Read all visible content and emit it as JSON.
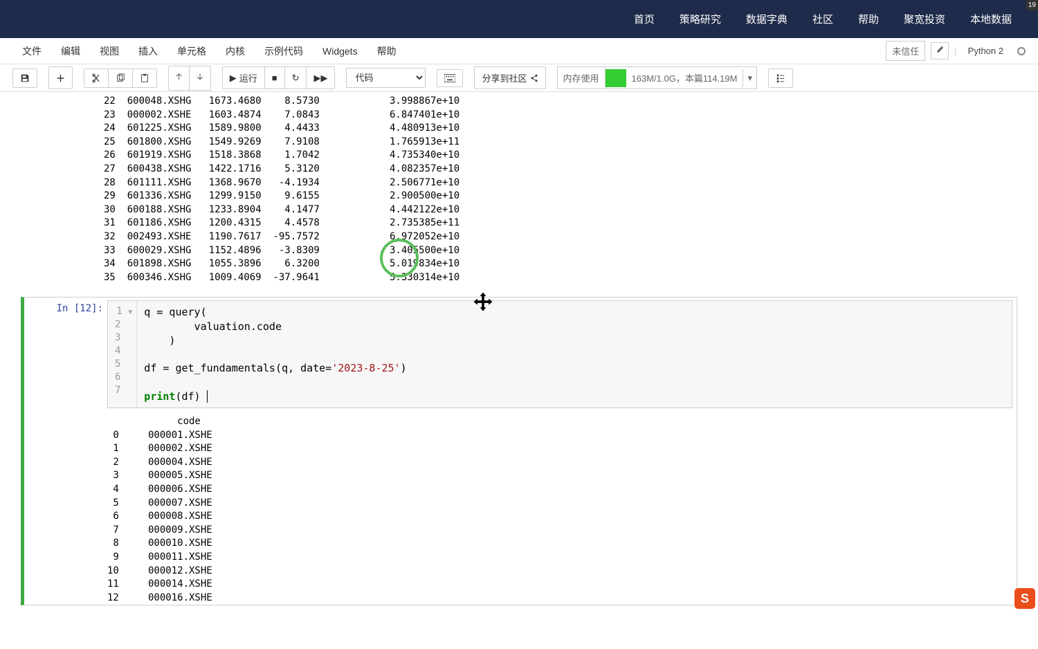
{
  "nav": {
    "items": [
      "首页",
      "策略研究",
      "数据字典",
      "社区",
      "帮助",
      "聚宽投资",
      "本地数据"
    ],
    "badge": "19"
  },
  "menu": {
    "items": [
      "文件",
      "编辑",
      "视图",
      "插入",
      "单元格",
      "内核",
      "示例代码",
      "Widgets",
      "帮助"
    ],
    "trusted": "未信任",
    "kernel": "Python 2"
  },
  "toolbar": {
    "run_label": "运行",
    "cell_type_selected": "代码",
    "share_label": "分享到社区",
    "mem_label": "内存使用",
    "mem_text": "163M/1.0G，本篇114.19M"
  },
  "output_top": {
    "rows": [
      {
        "idx": "22",
        "code": "600048.XSHG",
        "v1": "1673.4680",
        "v2": "8.5730",
        "v3": "3.998867e+10"
      },
      {
        "idx": "23",
        "code": "000002.XSHE",
        "v1": "1603.4874",
        "v2": "7.0843",
        "v3": "6.847401e+10"
      },
      {
        "idx": "24",
        "code": "601225.XSHG",
        "v1": "1589.9800",
        "v2": "4.4433",
        "v3": "4.480913e+10"
      },
      {
        "idx": "25",
        "code": "601800.XSHG",
        "v1": "1549.9269",
        "v2": "7.9108",
        "v3": "1.765913e+11"
      },
      {
        "idx": "26",
        "code": "601919.XSHG",
        "v1": "1518.3868",
        "v2": "1.7042",
        "v3": "4.735340e+10"
      },
      {
        "idx": "27",
        "code": "600438.XSHG",
        "v1": "1422.1716",
        "v2": "5.3120",
        "v3": "4.082357e+10"
      },
      {
        "idx": "28",
        "code": "601111.XSHG",
        "v1": "1368.9670",
        "v2": "-4.1934",
        "v3": "2.506771e+10"
      },
      {
        "idx": "29",
        "code": "601336.XSHG",
        "v1": "1299.9150",
        "v2": "9.6155",
        "v3": "2.900500e+10"
      },
      {
        "idx": "30",
        "code": "600188.XSHG",
        "v1": "1233.8904",
        "v2": "4.1477",
        "v3": "4.442122e+10"
      },
      {
        "idx": "31",
        "code": "601186.XSHG",
        "v1": "1200.4315",
        "v2": "4.4578",
        "v3": "2.735385e+11"
      },
      {
        "idx": "32",
        "code": "002493.XSHE",
        "v1": "1190.7617",
        "v2": "-95.7572",
        "v3": "6.972052e+10"
      },
      {
        "idx": "33",
        "code": "600029.XSHG",
        "v1": "1152.4896",
        "v2": "-3.8309",
        "v3": "3.405500e+10"
      },
      {
        "idx": "34",
        "code": "601898.XSHG",
        "v1": "1055.3896",
        "v2": "6.3200",
        "v3": "5.019834e+10"
      },
      {
        "idx": "35",
        "code": "600346.XSHG",
        "v1": "1009.4069",
        "v2": "-37.9641",
        "v3": "5.330314e+10"
      }
    ]
  },
  "cell": {
    "prompt": "In [12]:",
    "code_lines": [
      "q = query(",
      "        valuation.code",
      "    )",
      "",
      "df = get_fundamentals(q, date='2023-8-25')",
      "",
      "print(df) "
    ],
    "date_str": "'2023-8-25'"
  },
  "output_bottom": {
    "header": "            code",
    "rows": [
      {
        "idx": "0",
        "code": "000001.XSHE"
      },
      {
        "idx": "1",
        "code": "000002.XSHE"
      },
      {
        "idx": "2",
        "code": "000004.XSHE"
      },
      {
        "idx": "3",
        "code": "000005.XSHE"
      },
      {
        "idx": "4",
        "code": "000006.XSHE"
      },
      {
        "idx": "5",
        "code": "000007.XSHE"
      },
      {
        "idx": "6",
        "code": "000008.XSHE"
      },
      {
        "idx": "7",
        "code": "000009.XSHE"
      },
      {
        "idx": "8",
        "code": "000010.XSHE"
      },
      {
        "idx": "9",
        "code": "000011.XSHE"
      },
      {
        "idx": "10",
        "code": "000012.XSHE"
      },
      {
        "idx": "11",
        "code": "000014.XSHE"
      },
      {
        "idx": "12",
        "code": "000016.XSHE"
      }
    ]
  },
  "ime_icon": "S"
}
